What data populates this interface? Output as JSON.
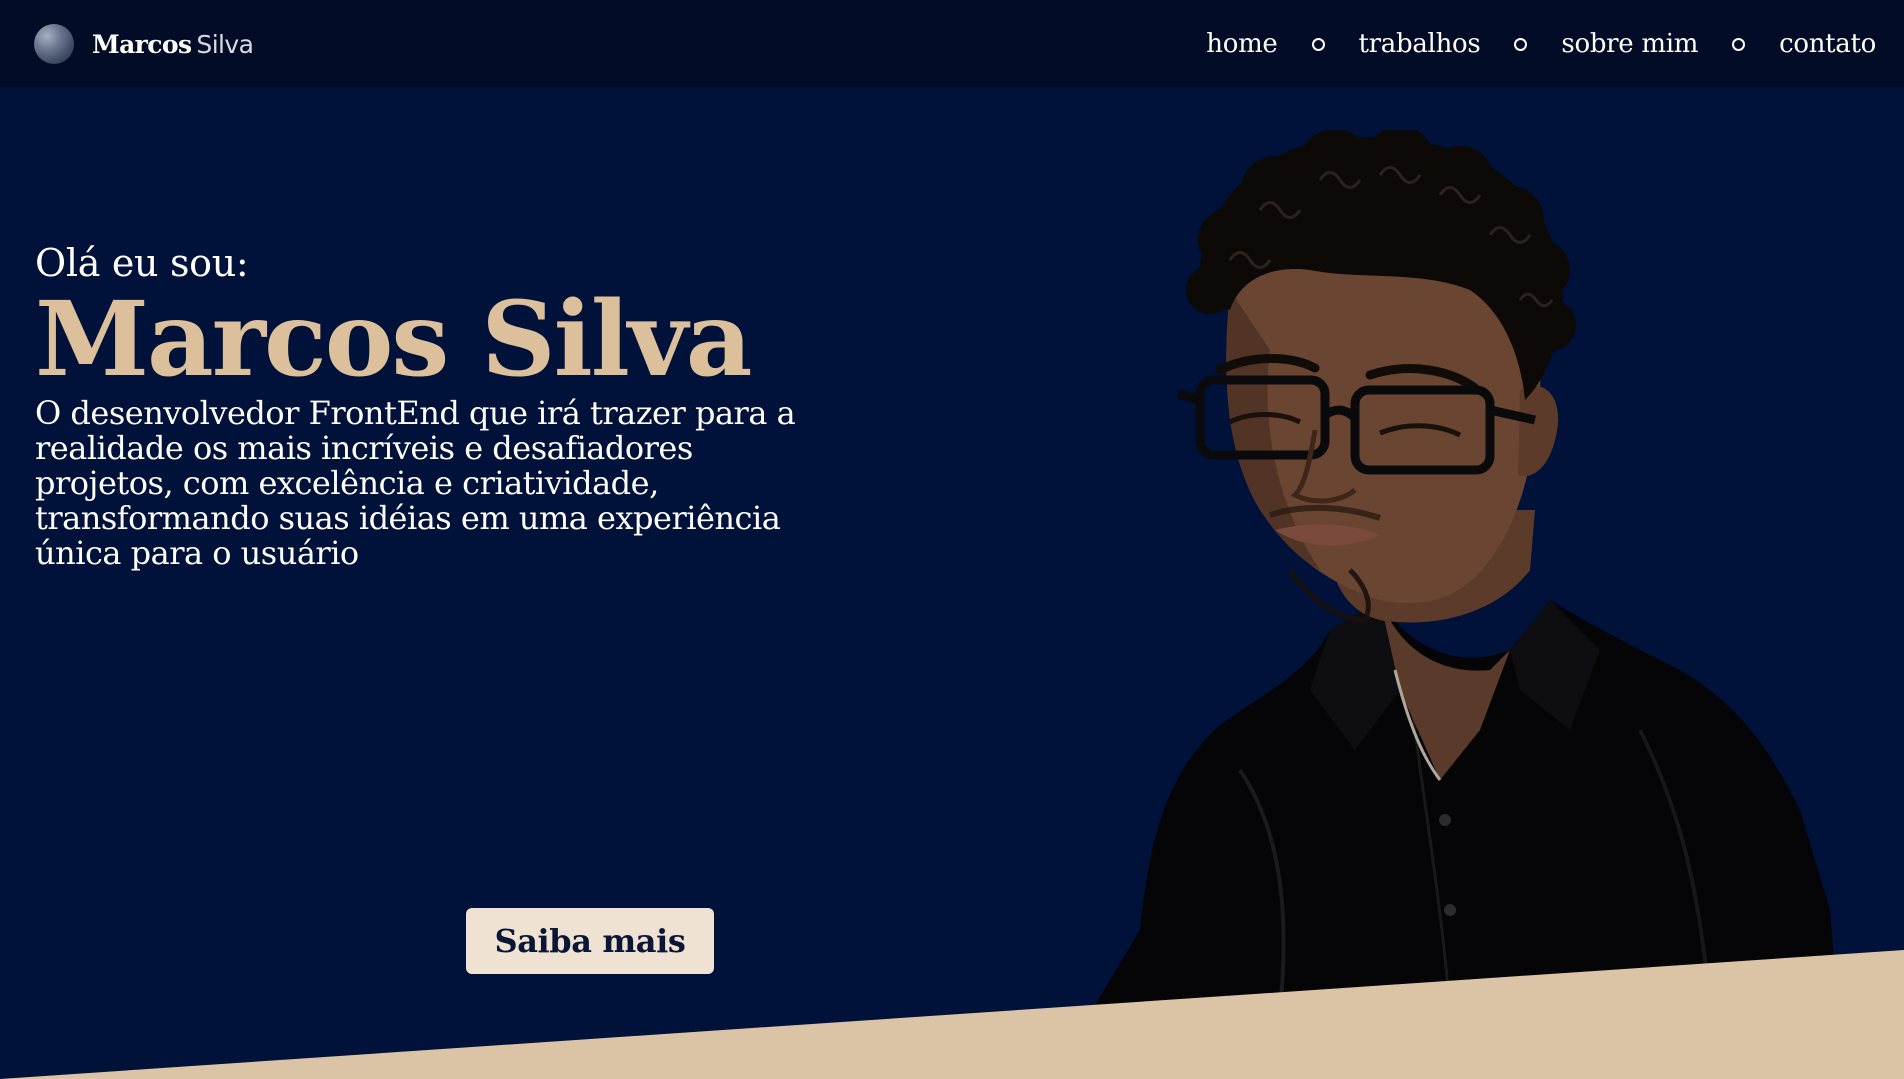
{
  "header": {
    "brand_first": "Marcos",
    "brand_last": "Silva",
    "nav": [
      "home",
      "trabalhos",
      "sobre mim",
      "contato"
    ]
  },
  "hero": {
    "greeting": "Olá eu sou:",
    "name": "Marcos Silva",
    "description": "O desenvolvedor FrontEnd que irá trazer para a realidade os mais incríveis e desafiadores projetos, com excelência e criatividade, transformando suas idéias em uma experiência única para o usuário",
    "cta_label": "Saiba mais"
  },
  "colors": {
    "background": "#00113a",
    "navbar": "#020c26",
    "accent": "#dcbf9b",
    "button": "#f0e2d2",
    "button_text": "#0a1636"
  }
}
